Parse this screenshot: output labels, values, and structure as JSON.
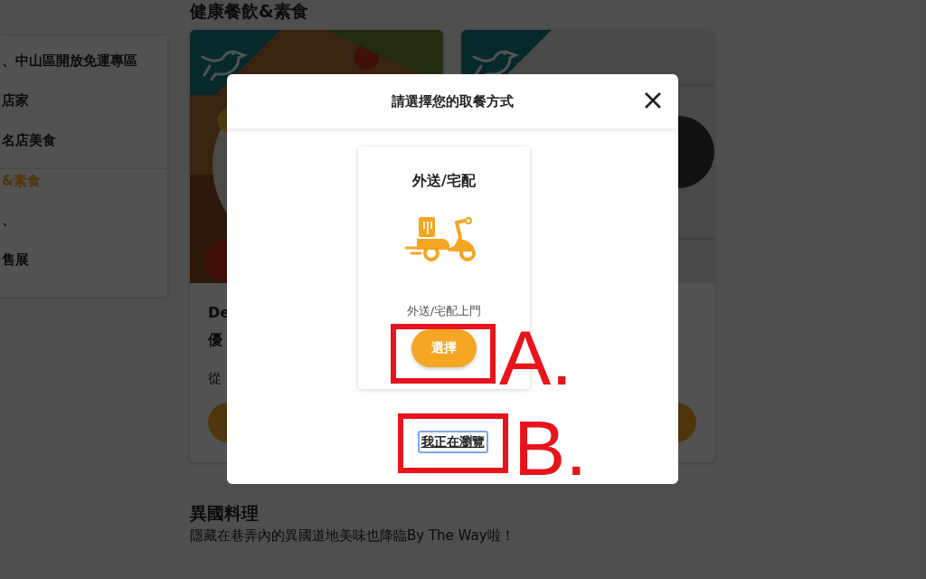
{
  "sidebar": {
    "items": [
      {
        "label": "、中山區開放免運專區",
        "selected": false
      },
      {
        "label": "店家",
        "selected": false
      },
      {
        "label": "名店美食",
        "selected": false
      },
      {
        "label": "&素食",
        "selected": true
      },
      {
        "label": "、",
        "selected": false
      },
      {
        "label": "售展",
        "selected": false
      }
    ]
  },
  "section_1": {
    "title": "健康餐飲&素食",
    "cards": [
      {
        "kind": "picture",
        "title_lines": [
          "De",
          "優"
        ],
        "text": "從"
      },
      {
        "kind": "picture"
      }
    ]
  },
  "section_2": {
    "title": "異國料理",
    "subtitle": "隱藏在巷弄內的異國道地美味也降臨By The Way啦！"
  },
  "modal": {
    "title": "請選擇您的取餐方式",
    "options": [
      {
        "title": "外送/宅配",
        "description": "外送/宅配上門",
        "button": "選擇"
      }
    ],
    "browse_link": "我正在瀏覽"
  },
  "annotations": [
    {
      "label": "A."
    },
    {
      "label": "B."
    }
  ]
}
